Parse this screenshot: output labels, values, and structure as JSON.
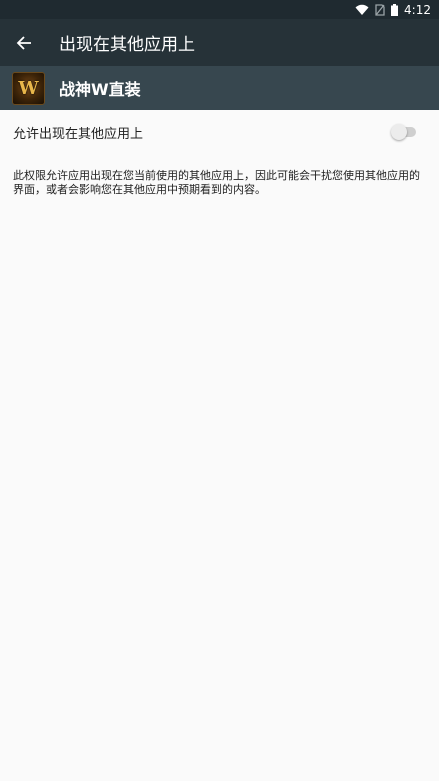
{
  "status_bar": {
    "time": "4:12",
    "icons": [
      "wifi-icon",
      "no-sim-icon",
      "battery-icon"
    ]
  },
  "toolbar": {
    "back_icon": "arrow-left-icon",
    "title": "出现在其他应用上"
  },
  "app": {
    "name": "战神W直装",
    "icon_letter": "W"
  },
  "setting": {
    "label": "允许出现在其他应用上",
    "enabled": false
  },
  "description": "此权限允许应用出现在您当前使用的其他应用上，因此可能会干扰您使用其他应用的界面，或者会影响您在其他应用中预期看到的内容。",
  "colors": {
    "status_bar": "#1f2a30",
    "toolbar": "#263238",
    "app_header": "#37474f",
    "background": "#fafafa"
  }
}
